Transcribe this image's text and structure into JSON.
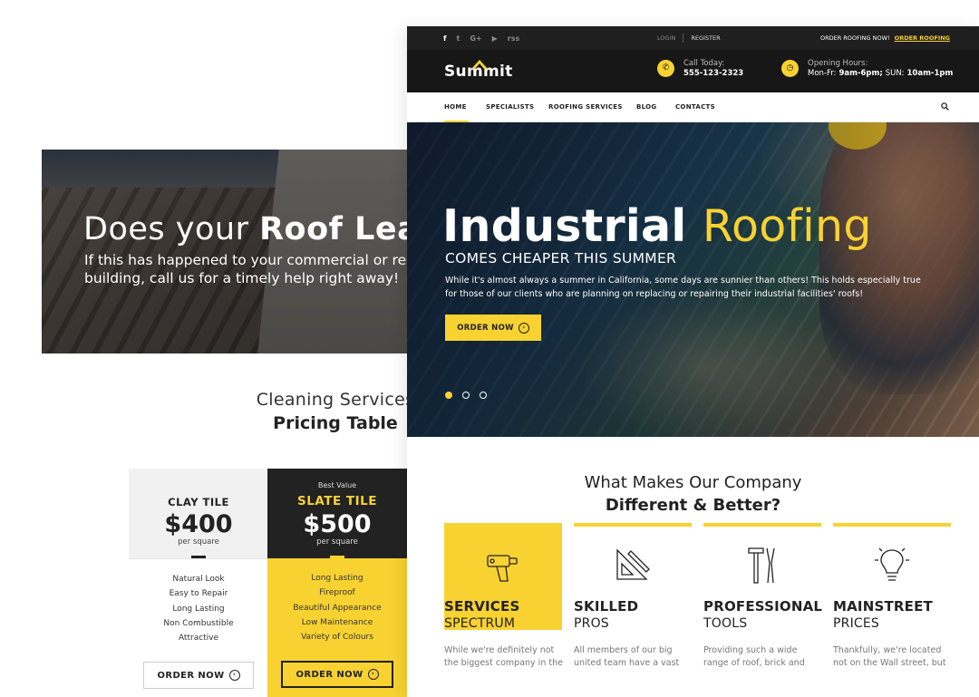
{
  "back": {
    "hero_title_light": "Does your",
    "hero_title_bold": "Roof Lea",
    "hero_text": "If this has happened to your commercial or reside building, call us for a timely help right away!",
    "pricing_title_1": "Cleaning Services",
    "pricing_title_2": "Pricing Table",
    "plans": [
      {
        "badge": "",
        "name": "CLAY TILE",
        "price": "$400",
        "per": "per square",
        "features": [
          "Natural Look",
          "Easy to Repair",
          "Long Lasting",
          "Non Combustible",
          "Attractive"
        ],
        "button": "ORDER NOW"
      },
      {
        "badge": "Best Value",
        "name": "SLATE TILE",
        "price": "$500",
        "per": "per square",
        "features": [
          "Long Lasting",
          "Fireproof",
          "Beautiful Appearance",
          "Low Maintenance",
          "Variety of Colours"
        ],
        "button": "ORDER NOW"
      }
    ]
  },
  "topbar": {
    "social": [
      "f",
      "t",
      "G+",
      "▶",
      "rss"
    ],
    "login": "LOGIN",
    "register": "REGISTER",
    "order_text": "ORDER ROOFING NOW!",
    "order_link": "ORDER ROOFING"
  },
  "header": {
    "logo": "Summit",
    "call_label": "Call Today:",
    "call_value": "555-123-2323",
    "hours_label": "Opening Hours:",
    "hours_mon_label": "Mon-Fr:",
    "hours_mon": "9am-6pm;",
    "hours_sun_label": "SUN:",
    "hours_sun": "10am-1pm"
  },
  "nav": {
    "items": [
      "HOME",
      "SPECIALISTS",
      "ROOFING SERVICES",
      "BLOG",
      "CONTACTS"
    ]
  },
  "hero": {
    "title_bold": "Industrial",
    "title_accent": "Roofing",
    "subtitle": "COMES CHEAPER THIS SUMMER",
    "description": "While it's almost always a summer in California, some days are sunnier than others! This holds especially true for those of our clients who are planning on replacing or repairing their industrial facilities' roofs!",
    "cta": "ORDER NOW",
    "slides": 3,
    "active_slide": 1
  },
  "why": {
    "line1": "What Makes Our Company",
    "line2": "Different & Better?",
    "features": [
      {
        "t1": "SERVICES",
        "t2": "SPECTRUM",
        "icon": "drill-icon",
        "text": "While we're definitely not the biggest company in the"
      },
      {
        "t1": "SKILLED",
        "t2": "PROS",
        "icon": "ruler-pencil-icon",
        "text": "All members of our big united team have a vast"
      },
      {
        "t1": "PROFESSIONAL",
        "t2": "TOOLS",
        "icon": "tools-icon",
        "text": "Providing such a wide range of roof, brick and"
      },
      {
        "t1": "MAINSTREET",
        "t2": "PRICES",
        "icon": "lightbulb-icon",
        "text": "Thankfully, we're located not on the Wall street, but"
      }
    ]
  },
  "colors": {
    "accent": "#f8d231",
    "dark": "#1f1f1f"
  }
}
